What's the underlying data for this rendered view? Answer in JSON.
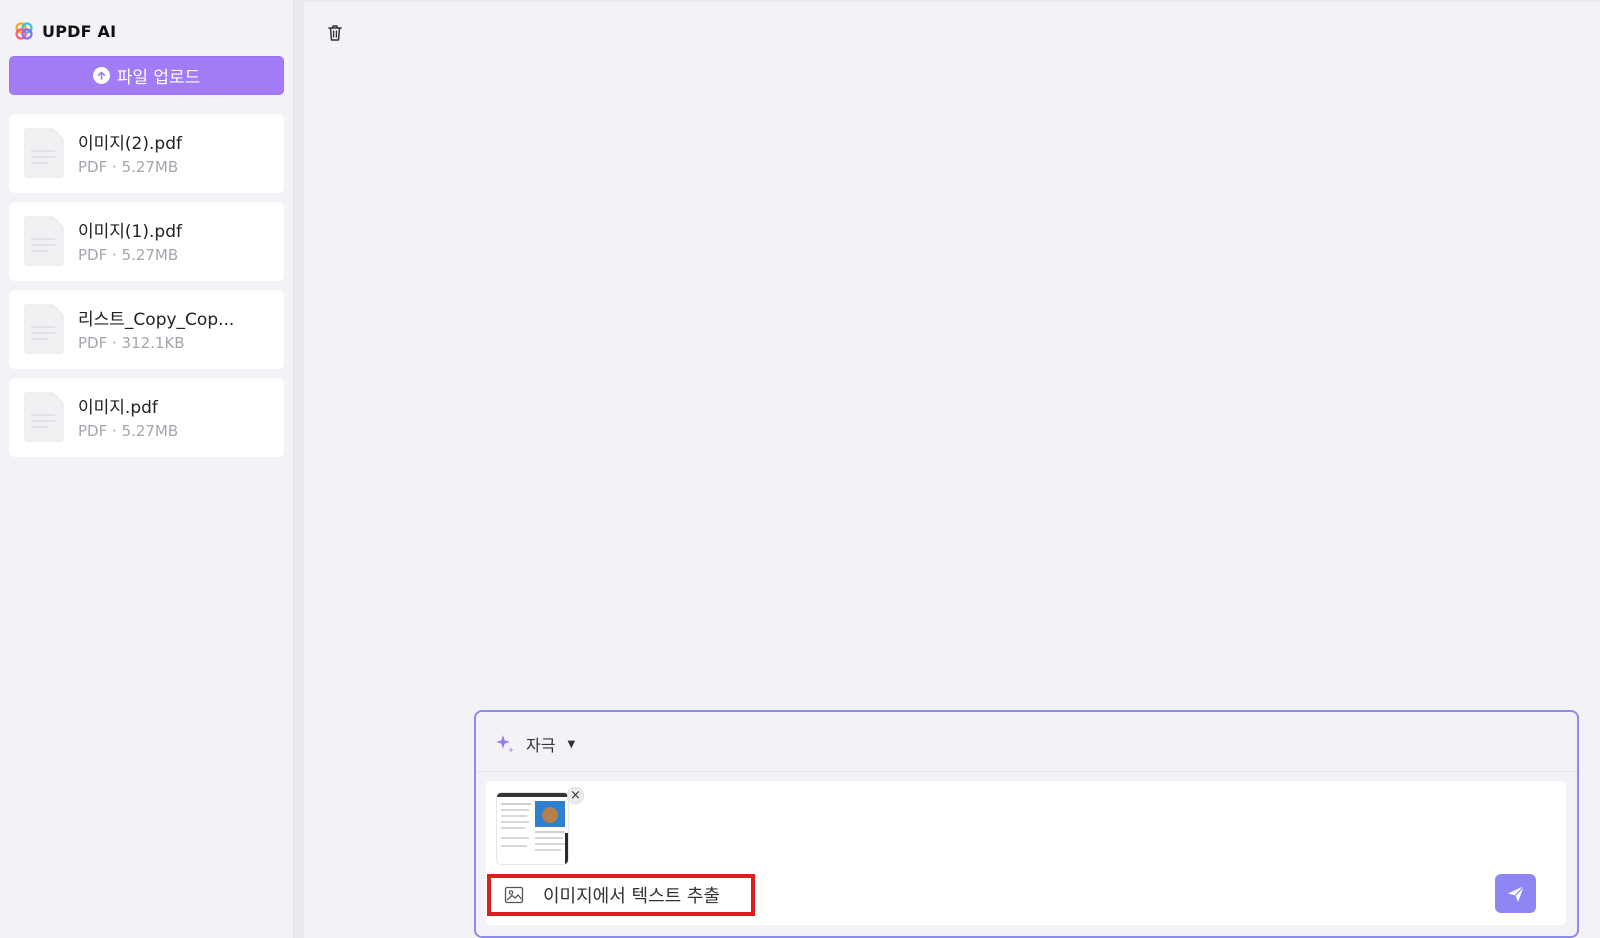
{
  "app": {
    "name": "UPDF AI",
    "upload_label": "파일 업로드"
  },
  "files": [
    {
      "name": "이미지(2).pdf",
      "meta": "PDF · 5.27MB"
    },
    {
      "name": "이미지(1).pdf",
      "meta": "PDF · 5.27MB"
    },
    {
      "name": "리스트_Copy_Cop...",
      "meta": "PDF · 312.1KB"
    },
    {
      "name": "이미지.pdf",
      "meta": "PDF · 5.27MB"
    }
  ],
  "chat": {
    "mode_label": "자극",
    "input_value": "이미지에서 텍스트 추출"
  },
  "colors": {
    "accent": "#a27cf7",
    "send": "#8f86f4",
    "highlight": "#e01c1c"
  },
  "icons": {
    "brand": "updf-logo-icon",
    "upload": "arrow-up-circle-icon",
    "file": "document-icon",
    "trash": "trash-icon",
    "mode": "sparkle-icon",
    "image": "image-icon",
    "send": "send-icon",
    "close": "close-icon"
  }
}
